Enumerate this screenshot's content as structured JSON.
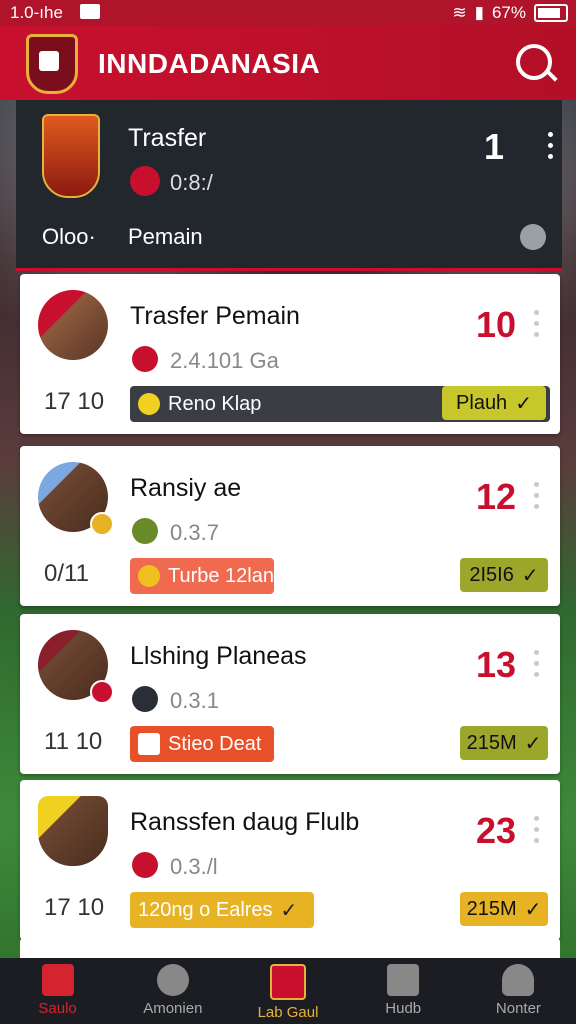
{
  "status_bar": {
    "time": "1.0-ıhe",
    "battery": "67%"
  },
  "app_bar": {
    "title": "INNDADANASIA"
  },
  "header": {
    "title": "Trasfer",
    "subtitle": "0:8:/",
    "count": "1",
    "filter_label": "Oloo·",
    "filter_value": "Pemain"
  },
  "cards": [
    {
      "name": "Trasfer Pemain",
      "sub": "2.4.101 Ga",
      "number": "10",
      "date": "17 10",
      "tag": "Reno Klap",
      "tag_color": "#3a3e44",
      "value": "Plauh",
      "value_color": "#c7c72b"
    },
    {
      "name": "Ransiy ae",
      "sub": "0.3.7",
      "number": "12",
      "date": "0/11",
      "tag": "Turbe 12lan",
      "tag_color": "#f06a50",
      "value": "2I5I6",
      "value_color": "#9ca62b"
    },
    {
      "name": "Llshing Planeas",
      "sub": "0.3.1",
      "number": "13",
      "date": "11 10",
      "tag": "Stieo Deat",
      "tag_color": "#e8502a",
      "value": "215M",
      "value_color": "#9ca62b"
    },
    {
      "name": "Ranssfen daug Flulb",
      "sub": "0.3./l",
      "number": "23",
      "date": "17 10",
      "tag": "120ng o Ealres",
      "tag_color": "#e8b225",
      "value": "215M",
      "value_color": "#e8b225"
    }
  ],
  "nav": [
    {
      "label": "Saulo",
      "icon": "home-icon",
      "active": true
    },
    {
      "label": "Amonien",
      "icon": "ball-icon",
      "active": false
    },
    {
      "label": "Lab Gaul",
      "icon": "club-crest-icon",
      "active": false
    },
    {
      "label": "Hudb",
      "icon": "grid-icon",
      "active": false
    },
    {
      "label": "Nonter",
      "icon": "user-icon",
      "active": false
    }
  ]
}
